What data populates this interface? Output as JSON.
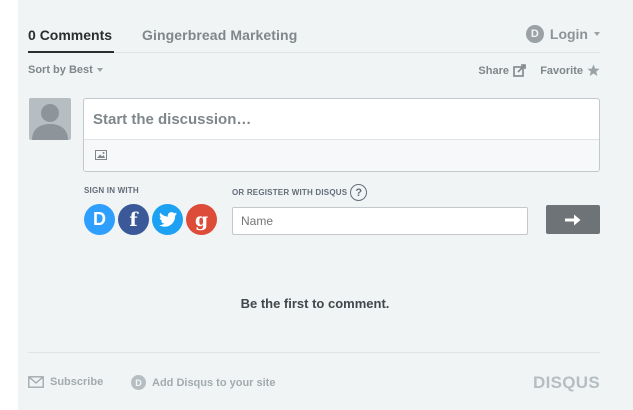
{
  "nav": {
    "comment_count": "0",
    "comments_suffix": "Comments",
    "community_name": "Gingerbread Marketing",
    "login_label": "Login",
    "login_icon_glyph": "D"
  },
  "toolbar": {
    "sort_label": "Sort by Best",
    "share_label": "Share",
    "favorite_label": "Favorite"
  },
  "composer": {
    "placeholder": "Start the discussion…"
  },
  "auth": {
    "signin_label": "SIGN IN WITH",
    "register_label": "OR REGISTER WITH DISQUS",
    "help_glyph": "?",
    "providers": [
      {
        "name": "disqus",
        "glyph": "D",
        "color": "#2e9fff"
      },
      {
        "name": "facebook",
        "glyph": "f",
        "color": "#3b5998"
      },
      {
        "name": "twitter",
        "glyph": "twitter-bird",
        "color": "#1da1f2"
      },
      {
        "name": "google",
        "glyph": "g",
        "color": "#dd4b39"
      }
    ],
    "name_placeholder": "Name"
  },
  "empty_state": "Be the first to comment.",
  "footer": {
    "subscribe_label": "Subscribe",
    "add_disqus_label": "Add Disqus to your site",
    "add_disqus_glyph": "D",
    "brand": "DISQUS"
  },
  "colors": {
    "background": "#f0f4f5",
    "submit": "#6d7377",
    "text_muted": "#7f878a"
  }
}
